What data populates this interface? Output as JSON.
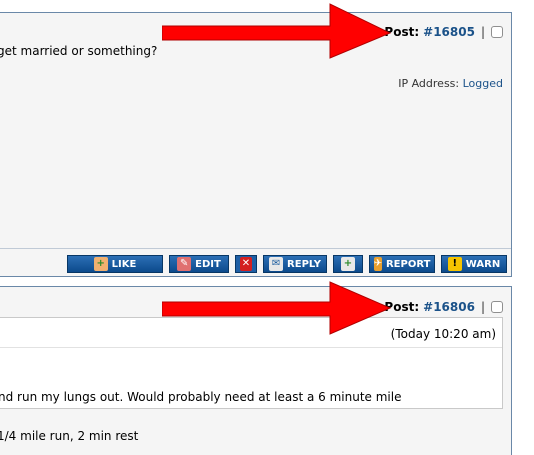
{
  "post1": {
    "label": "Post:",
    "number": "#16805",
    "pipe": "|",
    "message": "get married or something?",
    "ip_label": "IP Address:",
    "ip_value": "Logged"
  },
  "buttons": {
    "like": "LIKE",
    "edit": "EDIT",
    "reply": "REPLY",
    "report": "REPORT",
    "warn": "WARN"
  },
  "post2": {
    "label": "Post:",
    "number": "#16806",
    "pipe": "|",
    "quote_date": "(Today 10:20 am)",
    "quote_text": "nd run my lungs out. Would probably need at least a 6 minute mile",
    "message": "1/4 mile run, 2 min rest"
  },
  "colors": {
    "arrow": "#ff0000",
    "link": "#1b5289",
    "button": "#0c4a8c"
  }
}
